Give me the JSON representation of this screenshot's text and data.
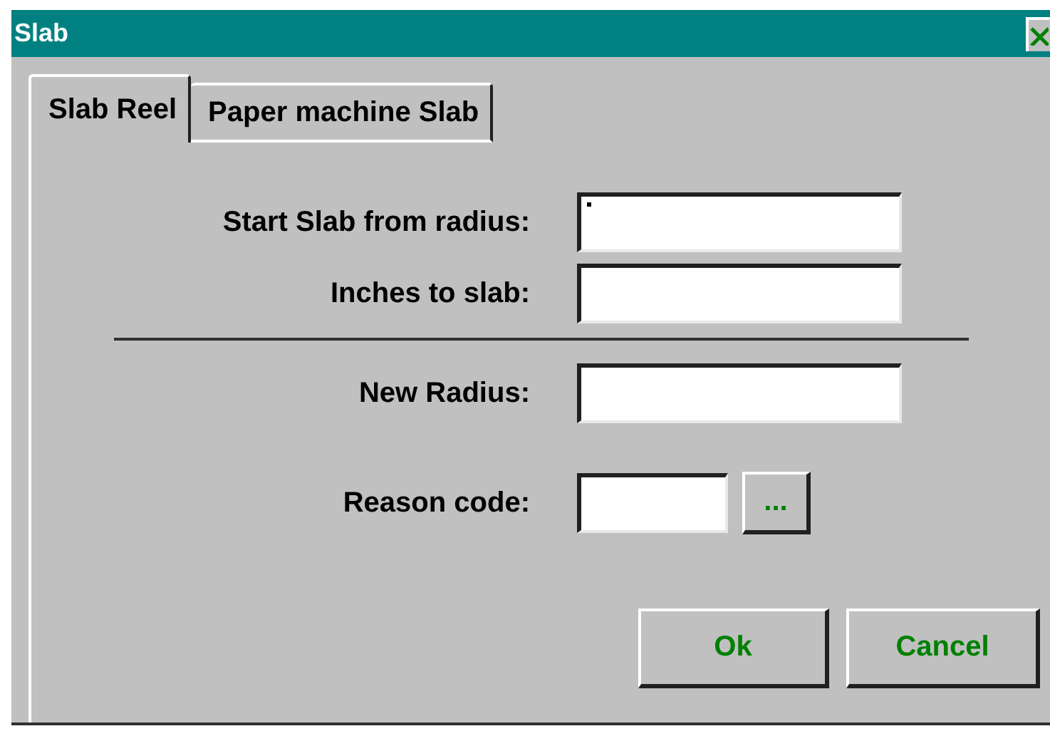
{
  "window": {
    "title": "Slab"
  },
  "tabs": [
    {
      "label": "Slab Reel",
      "selected": true
    },
    {
      "label": "Paper machine Slab",
      "selected": false
    }
  ],
  "upper_fields": [
    {
      "label": "Start Slab from radius:",
      "focused": true
    },
    {
      "label": "Inches to slab:",
      "focused": false
    }
  ],
  "lower_fields": [
    {
      "label": "New Radius:",
      "focused": false
    }
  ],
  "reason": {
    "label": "Reason code:",
    "browse": "..."
  },
  "buttons": [
    "Ok",
    "Cancel"
  ]
}
